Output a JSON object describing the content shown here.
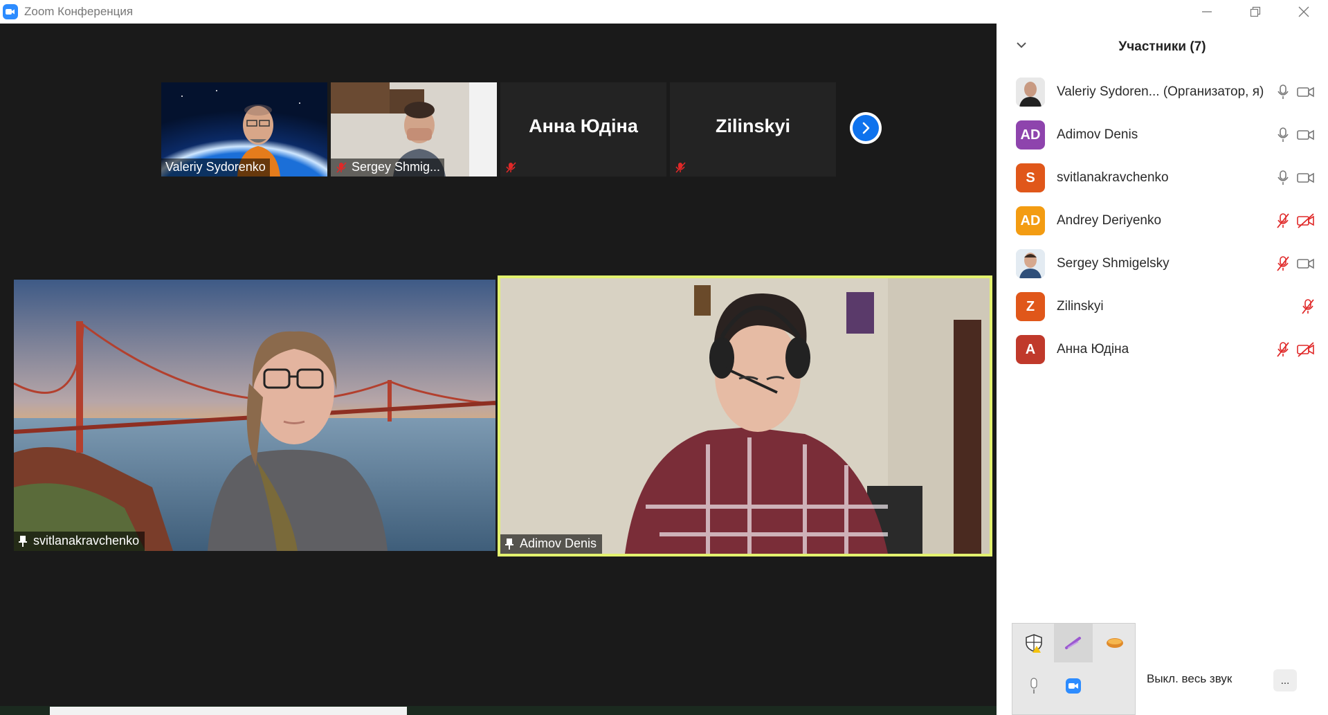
{
  "window": {
    "title": "Zoom Конференция"
  },
  "gallery_strip": [
    {
      "name": "Valeriy Sydorenko",
      "muted": false,
      "has_video": true
    },
    {
      "name": "Sergey Shmig...",
      "muted": true,
      "has_video": true
    },
    {
      "name": "Анна Юдіна",
      "muted": true,
      "has_video": false
    },
    {
      "name": "Zilinskyi",
      "muted": true,
      "has_video": false
    }
  ],
  "main_tiles": [
    {
      "name": "svitlanakravchenko",
      "pinned": true,
      "active_speaker": false
    },
    {
      "name": "Adimov Denis",
      "pinned": true,
      "active_speaker": true
    }
  ],
  "participants_panel": {
    "title": "Участники (7)",
    "participants": [
      {
        "name": "Valeriy Sydoren... (Организатор, я)",
        "avatar": "photo",
        "avatar_color": "#cccccc",
        "mic": "on",
        "cam": "on"
      },
      {
        "name": "Adimov Denis",
        "avatar": "AD",
        "avatar_color": "#8e44ad",
        "mic": "on",
        "cam": "on"
      },
      {
        "name": "svitlanakravchenko",
        "avatar": "S",
        "avatar_color": "#e0571a",
        "mic": "on",
        "cam": "on"
      },
      {
        "name": "Andrey Deriyenko",
        "avatar": "AD",
        "avatar_color": "#f39c12",
        "mic": "off",
        "cam": "off"
      },
      {
        "name": "Sergey Shmigelsky",
        "avatar": "photo",
        "avatar_color": "#d7e3ee",
        "mic": "off",
        "cam": "on"
      },
      {
        "name": "Zilinskyi",
        "avatar": "Z",
        "avatar_color": "#e0571a",
        "mic": "off",
        "cam": "none"
      },
      {
        "name": "Анна Юдіна",
        "avatar": "A",
        "avatar_color": "#c0392b",
        "mic": "off",
        "cam": "off"
      }
    ]
  },
  "footer": {
    "mute_all_label": "Выкл. весь звук",
    "more_label": "..."
  },
  "tray_icons": [
    "security-shield-icon",
    "pen-icon",
    "app-icon",
    "microphone-icon",
    "zoom-icon"
  ],
  "colors": {
    "accent": "#0e72ed",
    "active_speaker": "#e3f26f",
    "muted": "#e02828"
  }
}
